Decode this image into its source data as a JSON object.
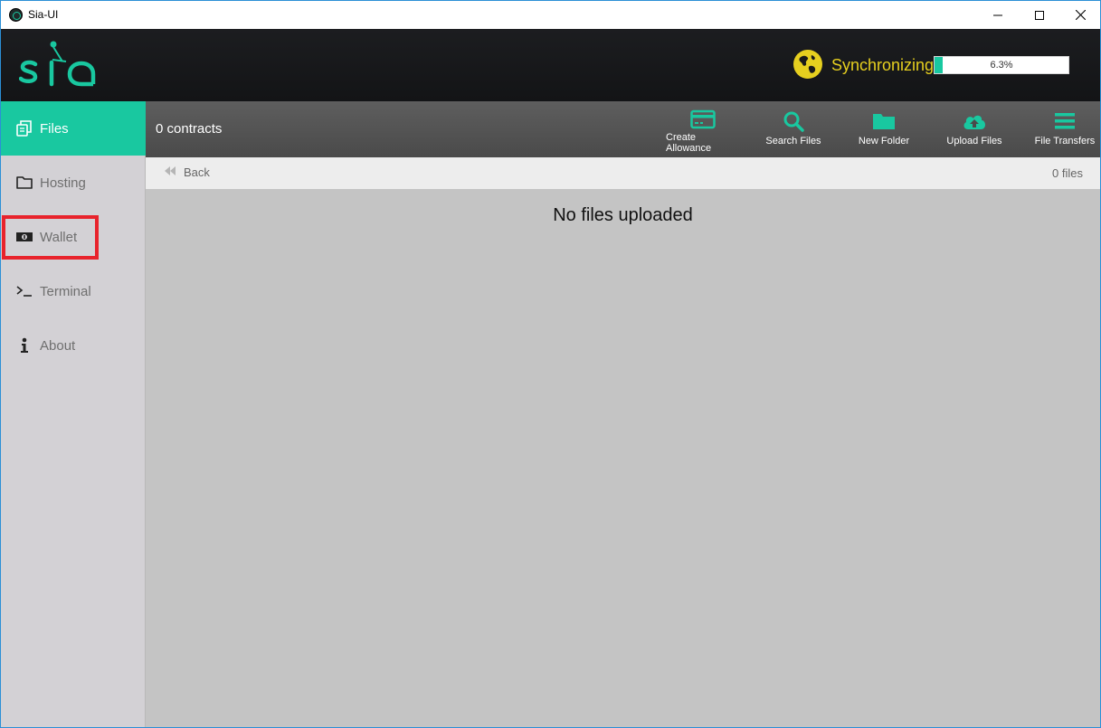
{
  "window": {
    "title": "Sia-UI"
  },
  "header": {
    "logo_text": "sia",
    "sync": {
      "label": "Synchronizing",
      "progress_text": "6.3%",
      "progress_value": 0.063
    }
  },
  "sidebar": {
    "items": [
      {
        "label": "Files",
        "icon": "files-icon",
        "active": true
      },
      {
        "label": "Hosting",
        "icon": "folder-icon"
      },
      {
        "label": "Wallet",
        "icon": "cash-icon"
      },
      {
        "label": "Terminal",
        "icon": "terminal-icon"
      },
      {
        "label": "About",
        "icon": "info-icon"
      }
    ]
  },
  "toolbar": {
    "contracts": "0 contracts",
    "buttons": [
      {
        "label": "Create Allowance",
        "icon": "credit-card-icon"
      },
      {
        "label": "Search Files",
        "icon": "search-icon"
      },
      {
        "label": "New Folder",
        "icon": "folder-icon"
      },
      {
        "label": "Upload Files",
        "icon": "cloud-upload-icon"
      },
      {
        "label": "File Transfers",
        "icon": "menu-icon"
      }
    ]
  },
  "breadcrumb": {
    "back_label": "Back",
    "file_count": "0 files"
  },
  "main": {
    "empty_message": "No files uploaded"
  },
  "colors": {
    "accent": "#19c8a0",
    "sync": "#e6cf1f",
    "highlight": "#e8232c"
  }
}
